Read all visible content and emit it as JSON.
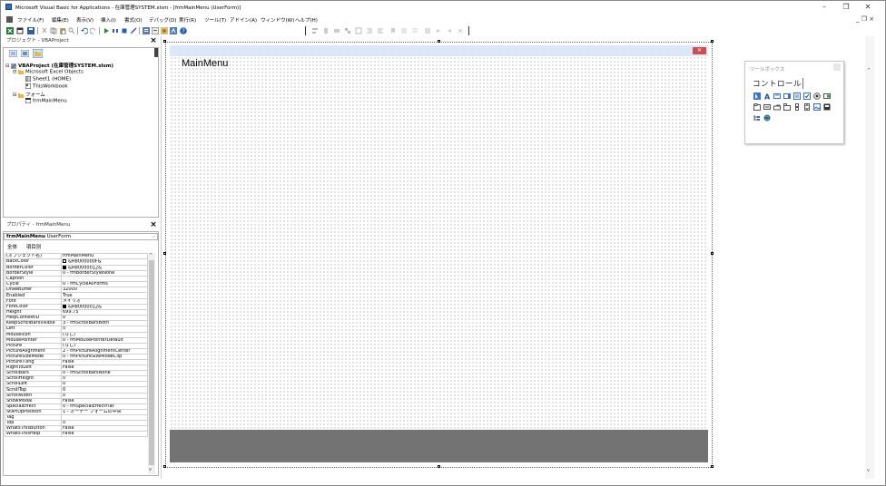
{
  "window": {
    "title": "Microsoft Visual Basic for Applications - 在庫管理SYSTEM.xlsm - [frmMainMenu (UserForm)]",
    "minimize": "–",
    "restore": "❐",
    "close": "✕",
    "mdi_controls": "_ ❐ ×"
  },
  "menu": [
    "ファイル(F)",
    "編集(E)",
    "表示(V)",
    "挿入(I)",
    "書式(O)",
    "デバッグ(D)",
    "実行(R)",
    "ツール(T)",
    "アドイン(A)",
    "ウィンドウ(W)",
    "ヘルプ(H)"
  ],
  "project_pane": {
    "title": "プロジェクト - VBAProject",
    "tree": [
      {
        "label": "VBAProject (在庫管理SYSTEM.xlsm)",
        "bold": true
      },
      {
        "label": "Microsoft Excel Objects"
      },
      {
        "label": "Sheet1 (HOME)"
      },
      {
        "label": "ThisWorkbook"
      },
      {
        "label": "フォーム"
      },
      {
        "label": "frmMainMenu"
      }
    ]
  },
  "properties_pane": {
    "title": "プロパティ - frmMainMenu",
    "object_name": "frmMainMenu",
    "object_type": "UserForm",
    "tabs": [
      "全体",
      "項目別"
    ],
    "rows": [
      [
        "(オブジェクト名)",
        "frmMainMenu"
      ],
      [
        "BackColor",
        "&H8000000F&"
      ],
      [
        "BorderColor",
        "&H80000012&"
      ],
      [
        "BorderStyle",
        "0 - fmBorderStyleNone"
      ],
      [
        "Caption",
        ""
      ],
      [
        "Cycle",
        "0 - fmCycleAllForms"
      ],
      [
        "DrawBuffer",
        "32000"
      ],
      [
        "Enabled",
        "True"
      ],
      [
        "Font",
        "メイリオ"
      ],
      [
        "ForeColor",
        "&H80000012&"
      ],
      [
        "Height",
        "699.75"
      ],
      [
        "HelpContextID",
        "0"
      ],
      [
        "KeepScrollBarsVisible",
        "3 - fmScrollBarsBoth"
      ],
      [
        "Left",
        "0"
      ],
      [
        "MouseIcon",
        "(なし)"
      ],
      [
        "MousePointer",
        "0 - fmMousePointerDefault"
      ],
      [
        "Picture",
        "(なし)"
      ],
      [
        "PictureAlignment",
        "2 - fmPictureAlignmentCenter"
      ],
      [
        "PictureSizeMode",
        "0 - fmPictureSizeModeClip"
      ],
      [
        "PictureTiling",
        "False"
      ],
      [
        "RightToLeft",
        "False"
      ],
      [
        "ScrollBars",
        "0 - fmScrollBarsNone"
      ],
      [
        "ScrollHeight",
        "0"
      ],
      [
        "ScrollLeft",
        "0"
      ],
      [
        "ScrollTop",
        "0"
      ],
      [
        "ScrollWidth",
        "0"
      ],
      [
        "ShowModal",
        "False"
      ],
      [
        "SpecialEffect",
        "0 - fmSpecialEffectFlat"
      ],
      [
        "StartUpPosition",
        "1 - オーナー フォームの中央"
      ],
      [
        "Tag",
        ""
      ],
      [
        "Top",
        "0"
      ],
      [
        "WhatsThisButton",
        "False"
      ],
      [
        "WhatsThisHelp",
        "False"
      ]
    ]
  },
  "userform": {
    "caption": "MainMenu",
    "close_glyph": "✕"
  },
  "toolbox": {
    "title": "ツールボックス",
    "tab": "コントロール"
  },
  "colors": {
    "form_title_bg": "#dce8f5",
    "form_footer": "#737373",
    "close_red": "#c75050"
  }
}
